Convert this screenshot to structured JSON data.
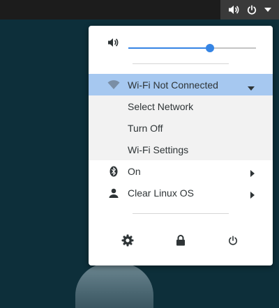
{
  "top_panel": {
    "icons": [
      "volume-icon",
      "power-icon",
      "dropdown-arrow-icon"
    ]
  },
  "menu": {
    "volume": {
      "level": 0.64,
      "icon": "speaker-icon"
    },
    "wifi": {
      "label": "Wi-Fi Not Connected",
      "icon": "wifi-icon",
      "submenu": [
        {
          "label": "Select Network"
        },
        {
          "label": "Turn Off"
        },
        {
          "label": "Wi-Fi Settings"
        }
      ]
    },
    "bluetooth": {
      "label": "On",
      "icon": "bluetooth-icon"
    },
    "user": {
      "label": "Clear Linux OS",
      "icon": "user-icon"
    },
    "actions": [
      "settings-icon",
      "lock-icon",
      "power-off-icon"
    ]
  },
  "colors": {
    "accent": "#3584e4",
    "highlight": "#a6c8f0",
    "panel": "#1c1c1c",
    "desktop": "#0d2f3a"
  }
}
